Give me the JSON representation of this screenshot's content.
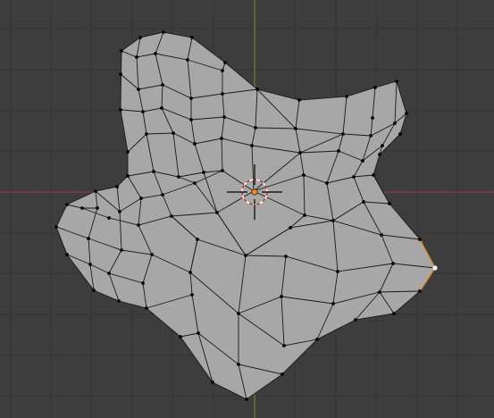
{
  "viewport": {
    "background_color": "#3d3d3d",
    "grid_color": "#333333",
    "x_axis_color": "#8a3a45",
    "y_axis_color": "#6b8a23"
  },
  "mesh": {
    "face_color": "#a7a7a7",
    "edge_color": "#1a1a1a",
    "vertex_color": "#000000",
    "selected_vertex_color": "#ffffff",
    "selected_edge_color": "#f08a24"
  },
  "cursor": {
    "icon": "3d-cursor-icon",
    "ring_colors": [
      "#ffffff",
      "#cc2b2b"
    ]
  },
  "origin": {
    "icon": "object-origin-icon",
    "color": "#f08a24"
  }
}
